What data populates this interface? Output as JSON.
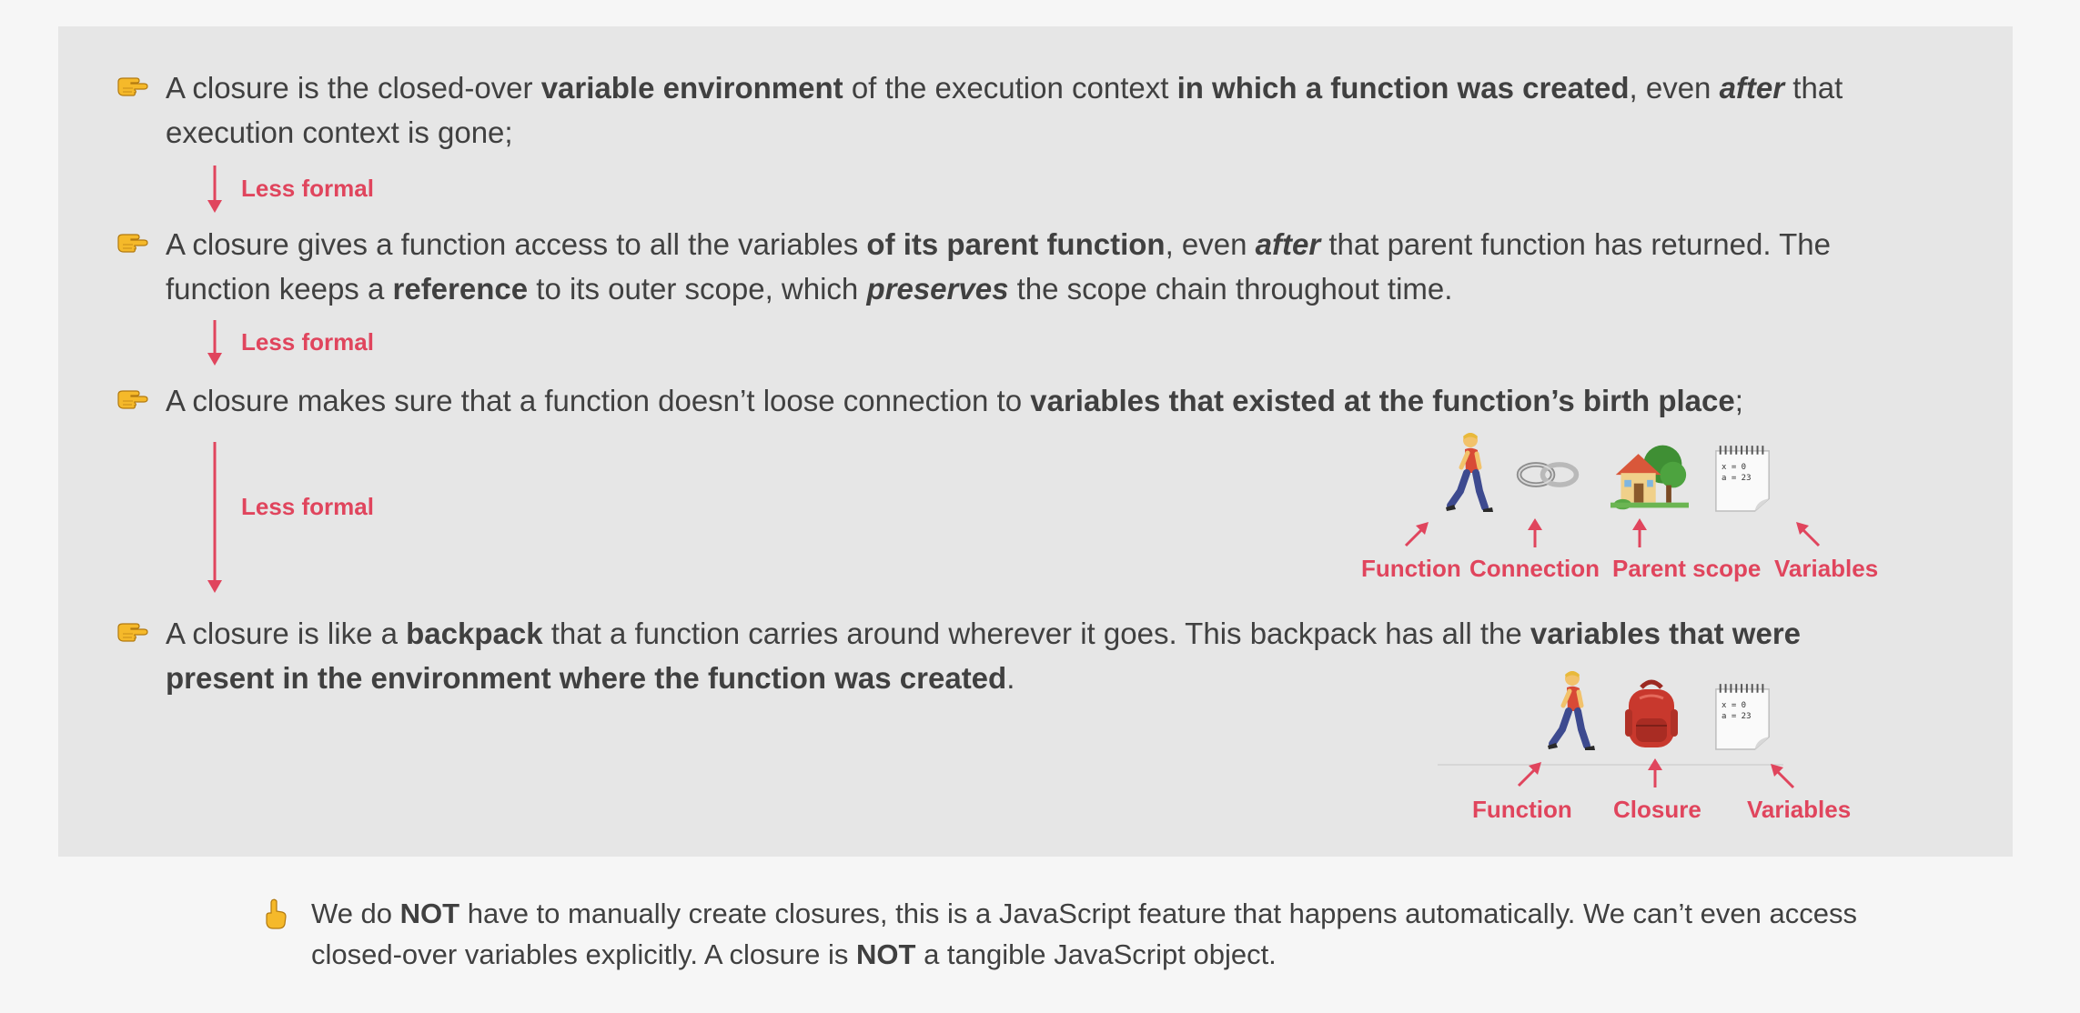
{
  "definitions": [
    {
      "segments": [
        {
          "text": "A closure is the closed-over ",
          "style": "normal"
        },
        {
          "text": "variable environment",
          "style": "bold"
        },
        {
          "text": " of the execution context ",
          "style": "normal"
        },
        {
          "text": "in which a function was created",
          "style": "bold"
        },
        {
          "text": ", even ",
          "style": "normal"
        },
        {
          "text": "after",
          "style": "bolditalic"
        },
        {
          "text": " that execution context is gone;",
          "style": "normal"
        }
      ]
    },
    {
      "segments": [
        {
          "text": "A closure gives a function access to all the variables ",
          "style": "normal"
        },
        {
          "text": "of its parent function",
          "style": "bold"
        },
        {
          "text": ", even ",
          "style": "normal"
        },
        {
          "text": "after",
          "style": "bolditalic"
        },
        {
          "text": " that parent function has returned. The function keeps a ",
          "style": "normal"
        },
        {
          "text": "reference",
          "style": "bold"
        },
        {
          "text": " to its outer scope, which ",
          "style": "normal"
        },
        {
          "text": "preserves",
          "style": "bolditalic"
        },
        {
          "text": " the scope chain throughout time.",
          "style": "normal"
        }
      ]
    },
    {
      "segments": [
        {
          "text": "A closure makes sure that a function doesn’t loose connection to ",
          "style": "normal"
        },
        {
          "text": "variables that existed at the function’s birth place",
          "style": "bold"
        },
        {
          "text": ";",
          "style": "normal"
        }
      ]
    },
    {
      "segments": [
        {
          "text": "A closure is like a ",
          "style": "normal"
        },
        {
          "text": "backpack",
          "style": "bold"
        },
        {
          "text": " that a function carries around wherever it goes. This backpack has all the ",
          "style": "normal"
        },
        {
          "text": "variables that were present in the environment where the function was created",
          "style": "bold"
        },
        {
          "text": ".",
          "style": "normal"
        }
      ]
    }
  ],
  "less_formal_labels": [
    "Less formal",
    "Less formal",
    "Less formal"
  ],
  "diagram_1": {
    "icons": [
      "walking-person-icon",
      "link-icon",
      "house-with-garden-icon",
      "notepad-icon"
    ],
    "captions": [
      "Function",
      "Connection",
      "Parent scope",
      "Variables"
    ],
    "notepad_text": [
      "x = 0",
      "a = 23"
    ]
  },
  "diagram_2": {
    "icons": [
      "walking-person-icon",
      "backpack-icon",
      "notepad-icon"
    ],
    "captions": [
      "Function",
      "Closure",
      "Variables"
    ],
    "notepad_text": [
      "x = 0",
      "a = 23"
    ]
  },
  "note": {
    "icon": "pointing-up-hand-icon",
    "segments": [
      {
        "text": "We do ",
        "style": "normal"
      },
      {
        "text": "NOT",
        "style": "bold"
      },
      {
        "text": " have to manually create closures, this is a JavaScript feature that happens automatically. We can’t even access closed-over variables explicitly. A closure is ",
        "style": "normal"
      },
      {
        "text": "NOT",
        "style": "bold"
      },
      {
        "text": " a tangible JavaScript object.",
        "style": "normal"
      }
    ]
  },
  "colors": {
    "accent": "#e0455d",
    "panel": "#e6e6e6",
    "page": "#f6f6f6",
    "text": "#404040"
  }
}
